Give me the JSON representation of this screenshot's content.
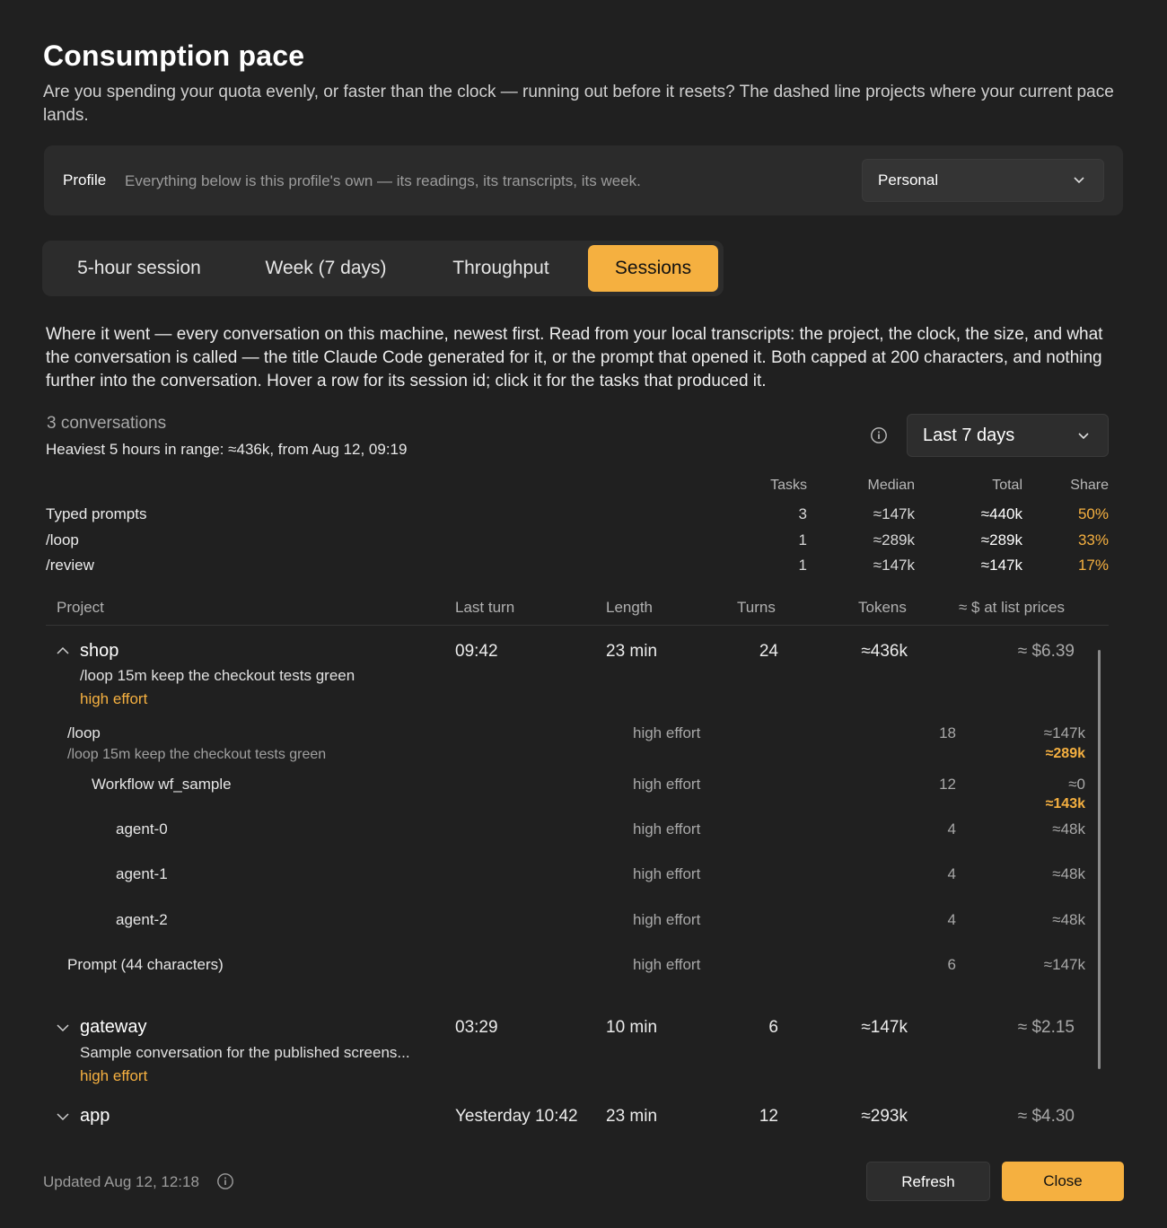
{
  "header": {
    "title": "Consumption pace",
    "subtitle": "Are you spending your quota evenly, or faster than the clock — running out before it resets? The dashed line projects where your current pace lands."
  },
  "profile": {
    "label": "Profile",
    "description": "Everything below is this profile's own — its readings, its transcripts, its week.",
    "selected": "Personal"
  },
  "tabs": [
    {
      "label": "5-hour session",
      "active": false
    },
    {
      "label": "Week (7 days)",
      "active": false
    },
    {
      "label": "Throughput",
      "active": false
    },
    {
      "label": "Sessions",
      "active": true
    }
  ],
  "sessions": {
    "description": "Where it went — every conversation on this machine, newest first. Read from your local transcripts: the project, the clock, the size, and what the conversation is called — the title Claude Code generated for it, or the prompt that opened it. Both capped at 200 characters, and nothing further into the conversation. Hover a row for its session id; click it for the tasks that produced it.",
    "conversation_count": "3 conversations",
    "heaviest": "Heaviest 5 hours in range: ≈436k, from Aug 12, 09:19",
    "range": "Last 7 days"
  },
  "summary": {
    "headers": {
      "tasks": "Tasks",
      "median": "Median",
      "total": "Total",
      "share": "Share"
    },
    "rows": [
      {
        "label": "Typed prompts",
        "tasks": "3",
        "median": "≈147k",
        "total": "≈440k",
        "share": "50%"
      },
      {
        "label": "/loop",
        "tasks": "1",
        "median": "≈289k",
        "total": "≈289k",
        "share": "33%"
      },
      {
        "label": "/review",
        "tasks": "1",
        "median": "≈147k",
        "total": "≈147k",
        "share": "17%"
      }
    ]
  },
  "table": {
    "headers": {
      "project": "Project",
      "last_turn": "Last turn",
      "length": "Length",
      "turns": "Turns",
      "tokens": "Tokens",
      "cost": "≈ $ at list prices"
    },
    "projects": [
      {
        "name": "shop",
        "expanded": true,
        "last_turn": "09:42",
        "length": "23 min",
        "turns": "24",
        "tokens": "≈436k",
        "cost": "≈ $6.39",
        "subtitle": "/loop 15m keep the checkout tests green",
        "effort": "high effort",
        "tasks": [
          {
            "name": "/loop",
            "sub": "/loop 15m keep the checkout tests green",
            "effort": "high effort",
            "turns": "18",
            "tokens": "≈147k",
            "tokens_total": "≈289k"
          },
          {
            "name": "Workflow wf_sample",
            "effort": "high effort",
            "turns": "12",
            "tokens": "≈0",
            "tokens_total": "≈143k"
          },
          {
            "name": "agent-0",
            "effort": "high effort",
            "turns": "4",
            "tokens": "≈48k"
          },
          {
            "name": "agent-1",
            "effort": "high effort",
            "turns": "4",
            "tokens": "≈48k"
          },
          {
            "name": "agent-2",
            "effort": "high effort",
            "turns": "4",
            "tokens": "≈48k"
          },
          {
            "name": "Prompt (44 characters)",
            "effort": "high effort",
            "turns": "6",
            "tokens": "≈147k"
          }
        ]
      },
      {
        "name": "gateway",
        "expanded": false,
        "last_turn": "03:29",
        "length": "10 min",
        "turns": "6",
        "tokens": "≈147k",
        "cost": "≈ $2.15",
        "subtitle": "Sample conversation for the published screens...",
        "effort": "high effort"
      },
      {
        "name": "app",
        "expanded": false,
        "last_turn": "Yesterday 10:42",
        "length": "23 min",
        "turns": "12",
        "tokens": "≈293k",
        "cost": "≈ $4.30"
      }
    ]
  },
  "footer": {
    "updated": "Updated Aug 12, 12:18",
    "refresh_label": "Refresh",
    "close_label": "Close"
  },
  "colors": {
    "background": "#202020",
    "accent": "#f5b040",
    "card": "#2b2b2b"
  }
}
